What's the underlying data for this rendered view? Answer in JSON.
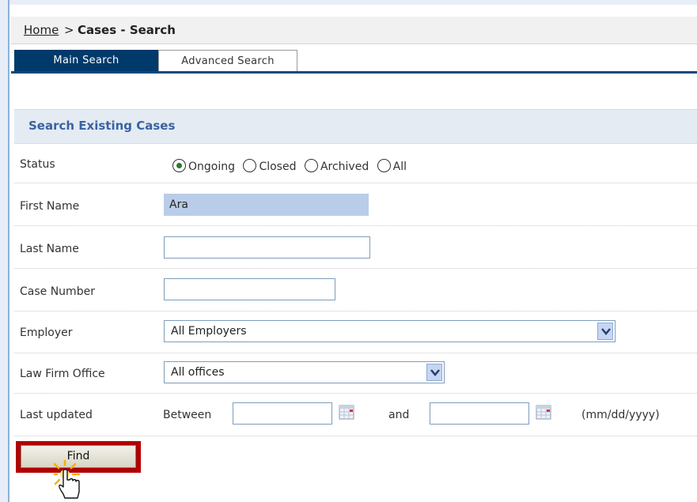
{
  "breadcrumb": {
    "home": "Home",
    "separator": ">",
    "current": "Cases - Search"
  },
  "tabs": [
    {
      "label": "Main Search",
      "active": true
    },
    {
      "label": "Advanced Search",
      "active": false
    }
  ],
  "section": {
    "title": "Search Existing Cases"
  },
  "fields": {
    "status": {
      "label": "Status",
      "options": [
        "Ongoing",
        "Closed",
        "Archived",
        "All"
      ],
      "selected": "Ongoing"
    },
    "first_name": {
      "label": "First Name",
      "value": "Ara"
    },
    "last_name": {
      "label": "Last Name",
      "value": ""
    },
    "case_number": {
      "label": "Case Number",
      "value": ""
    },
    "employer": {
      "label": "Employer",
      "value": "All Employers"
    },
    "law_firm_office": {
      "label": "Law Firm Office",
      "value": "All offices"
    },
    "last_updated": {
      "label": "Last updated",
      "between": "Between",
      "and": "and",
      "format_hint": "(mm/dd/yyyy)",
      "from": "",
      "to": ""
    }
  },
  "actions": {
    "find": "Find"
  },
  "colors": {
    "tab_active": "#003a6b",
    "section_title": "#3a62a3",
    "find_outline": "#b10000",
    "selected_input": "#b9cde8"
  },
  "icons": {
    "calendar": "calendar-icon",
    "dropdown": "chevron-down-icon",
    "cursor": "hand-pointer-icon"
  }
}
